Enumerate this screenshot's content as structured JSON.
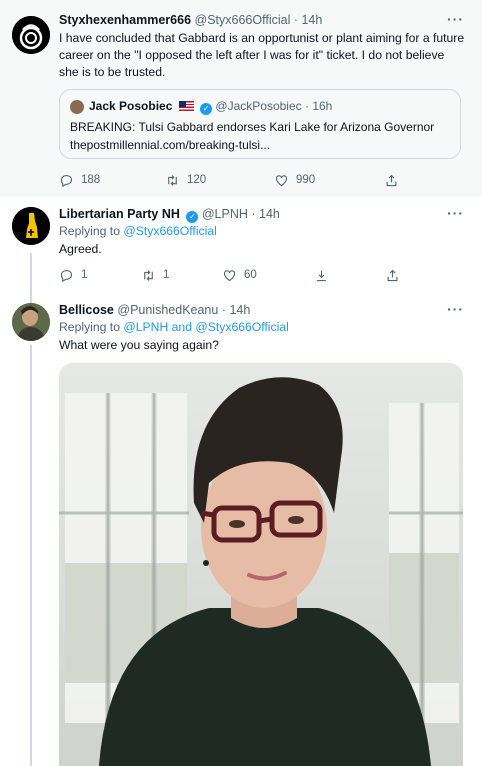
{
  "tweets": [
    {
      "name": "Styxhexenhammer666",
      "handle": "@Styx666Official",
      "time": "· 14h",
      "text": "I have concluded that Gabbard is an opportunist or plant aiming for a future career on the \"I opposed the left after I was for it\" ticket. I do not believe she is to be trusted.",
      "quote": {
        "name": "Jack Posobiec",
        "handle": "@JackPosobiec",
        "time": "· 16h",
        "text": "BREAKING: Tulsi Gabbard endorses Kari Lake for Arizona Governor",
        "link": "thepostmillennial.com/breaking-tulsi..."
      },
      "stats": {
        "replies": "188",
        "retweets": "120",
        "likes": "990"
      }
    },
    {
      "name": "Libertarian Party NH",
      "handle": "@LPNH",
      "time": "· 14h",
      "replying_prefix": "Replying to",
      "replying_to": "@Styx666Official",
      "text": "Agreed.",
      "stats": {
        "replies": "1",
        "retweets": "1",
        "likes": "60"
      }
    },
    {
      "name": "Bellicose",
      "handle": "@PunishedKeanu",
      "time": "· 14h",
      "replying_prefix": "Replying to",
      "replying_to": "@LPNH and @Styx666Official",
      "text": "What were you saying again?"
    }
  ],
  "more_label": "···",
  "verified_mark": "✓",
  "icons": [
    "reply-icon",
    "retweet-icon",
    "like-icon",
    "download-icon",
    "share-icon",
    "more-icon"
  ],
  "colors": {
    "accent": "#1d9bf0",
    "muted": "#536471",
    "highlight_bg": "#f7f9f9"
  }
}
